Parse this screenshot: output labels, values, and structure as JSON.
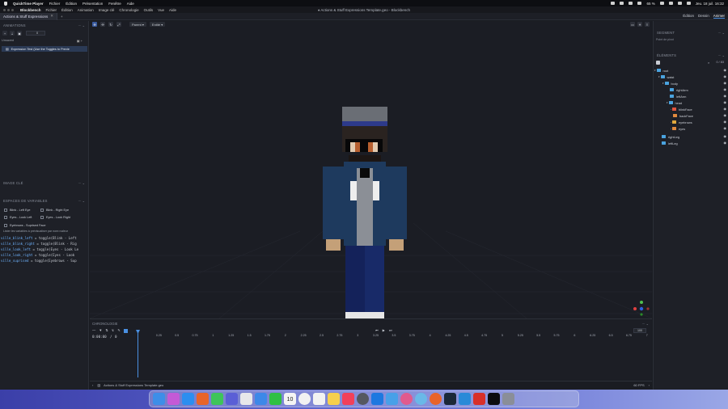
{
  "mac_menubar": {
    "app_name": "QuickTime Player",
    "items": [
      "Fichier",
      "Édition",
      "Présentation",
      "Fenêtre",
      "Aide"
    ],
    "battery": "65 %",
    "datetime": "Jeu. 18 juil.  16:32"
  },
  "app": {
    "name": "Blockbench",
    "menus": [
      "Fichier",
      "Édition",
      "Animation",
      "Image clé",
      "Chronologie",
      "Outils",
      "Vue",
      "Aide"
    ],
    "window_title": "♦ Actions & Stuff Expressions Template.geo - Blockbench"
  },
  "tabs": {
    "open_tab": "Actions & Stuff Expressions",
    "modes": [
      "Édition",
      "Dessin",
      "Animer"
    ],
    "active_mode": "Animer"
  },
  "left_panel": {
    "animations_title": "ANIMATIONS",
    "anim_field_value": "0",
    "unsaved_label": "Unsaved",
    "animation_item": "Expression Test (Use the Toggles to Previe",
    "keyframe_title": "IMAGE CLÉ",
    "variables_title": "ESPACES DE VARIABLES",
    "toggles": [
      {
        "label": "Blink - Left Eye"
      },
      {
        "label": "Blink - Right Eye"
      },
      {
        "label": "Eyes - Look Left"
      },
      {
        "label": "Eyes - Look Right"
      },
      {
        "label": "Eyebrows - Suprised Face"
      }
    ],
    "variables_hint": "Lister les variables à prévisualiser par nom=valeur",
    "code_lines": [
      {
        "name": "ville_blink_left",
        "rest": " = toggle(Blink - Left"
      },
      {
        "name": "ville_blink_right",
        "rest": " = toggle(Blink - Rig"
      },
      {
        "name": "ville_look_left",
        "rest": " = toggle(Eyes - Look Le"
      },
      {
        "name": "ville_look_right",
        "rest": " = toggle(Eyes - Look"
      },
      {
        "name": "ville_suprised",
        "rest": " = toggle(Eyebrows - Sup"
      }
    ]
  },
  "viewport": {
    "pivot_dropdown": "Parent",
    "space_dropdown": "Entité"
  },
  "right_panel": {
    "segment_title": "SEGMENT",
    "pivot_label": "Point de pivot",
    "elements_title": "ÉLÉMENTS",
    "element_count": "0 / 83",
    "tree": [
      {
        "label": "root",
        "depth": 0,
        "color": "#4aa3df"
      },
      {
        "label": "waist",
        "depth": 1,
        "color": "#4aa3df"
      },
      {
        "label": "body",
        "depth": 2,
        "color": "#4aa3df"
      },
      {
        "label": "rightArm",
        "depth": 3,
        "color": "#4aa3df"
      },
      {
        "label": "leftArm",
        "depth": 3,
        "color": "#4aa3df"
      },
      {
        "label": "head",
        "depth": 3,
        "color": "#4aa3df"
      },
      {
        "label": "blinkFace",
        "depth": 4,
        "color": "#e0553e"
      },
      {
        "label": "backFace",
        "depth": 4,
        "color": "#e08a3e"
      },
      {
        "label": "eyebrows",
        "depth": 4,
        "color": "#e0a93e"
      },
      {
        "label": "eyes",
        "depth": 4,
        "color": "#e08a3e"
      },
      {
        "label": "rightLeg",
        "depth": 1,
        "color": "#4aa3df"
      },
      {
        "label": "leftLeg",
        "depth": 1,
        "color": "#4aa3df"
      }
    ]
  },
  "timeline": {
    "title": "CHRONOLOGIE",
    "time_display": "0:00:00",
    "frame_display": "0",
    "zoom_value": "100",
    "ticks": [
      "0.25",
      "0.5",
      "0.75",
      "1",
      "1.25",
      "1.5",
      "1.75",
      "2",
      "2.25",
      "2.5",
      "2.75",
      "3",
      "3.25",
      "3.5",
      "3.75",
      "4",
      "4.25",
      "4.5",
      "4.75",
      "5",
      "5.25",
      "5.5",
      "5.75",
      "6",
      "6.25",
      "6.5",
      "6.75",
      "7"
    ]
  },
  "status_bar": {
    "file_name": "Actions & Stuff Expressions Template.geo",
    "fps": "60 FPS"
  },
  "dock": {
    "calendar_day": "10"
  }
}
